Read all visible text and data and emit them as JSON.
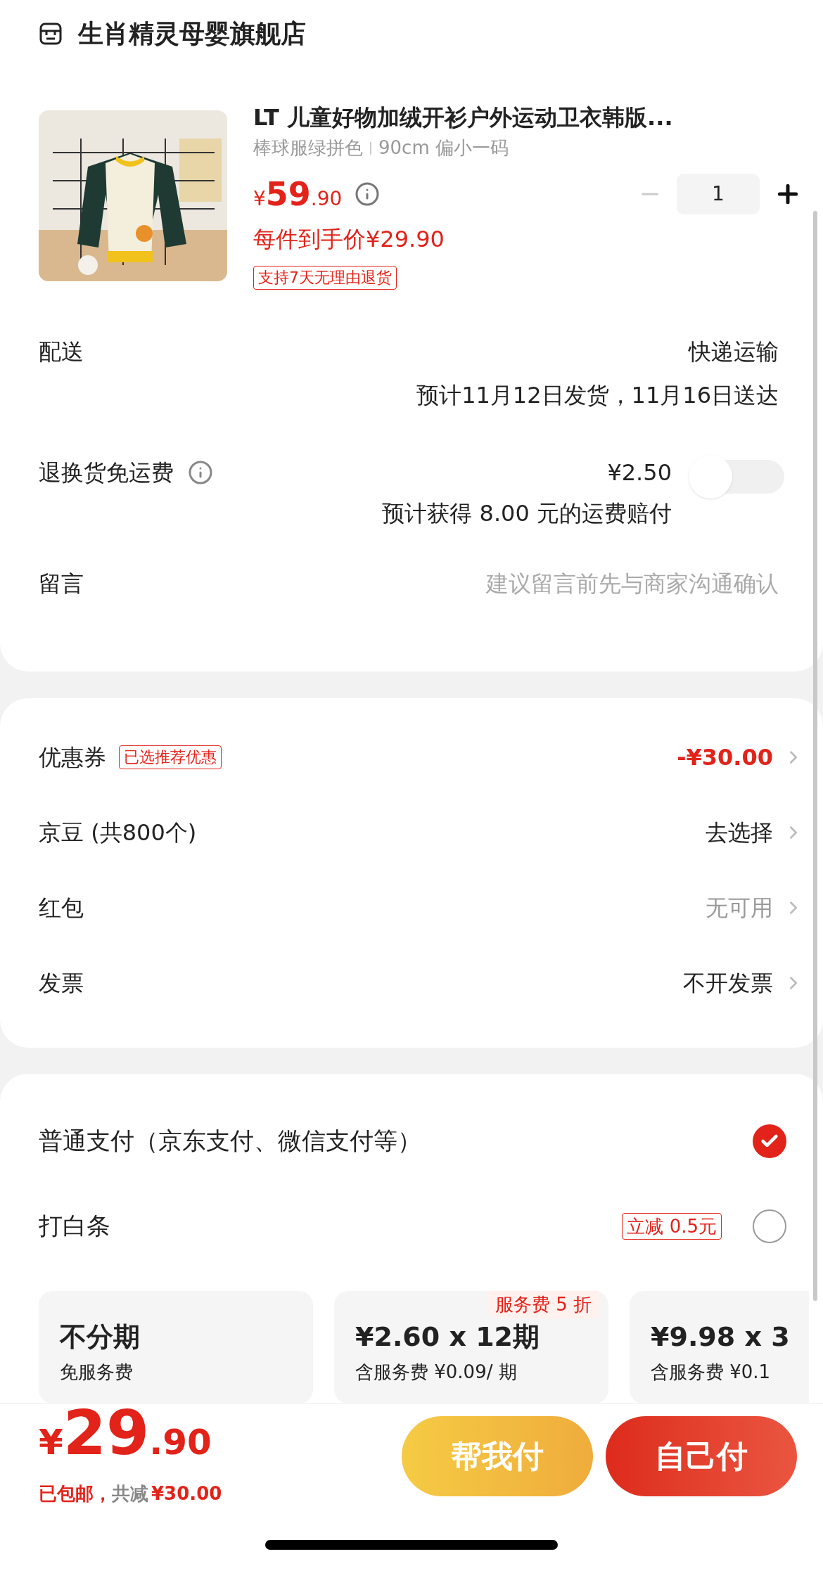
{
  "store": {
    "name": "生肖精灵母婴旗舰店"
  },
  "product": {
    "title": "LT 儿童好物加绒开衫户外运动卫衣韩版...",
    "variant_color": "棒球服绿拼色",
    "variant_size": "90cm 偏小一码",
    "currency": "¥",
    "price_int": "59",
    "price_dec": ".90",
    "quantity": "1",
    "unit_price": "每件到手价¥29.90",
    "tag": "支持7天无理由退货"
  },
  "delivery": {
    "label": "配送",
    "method": "快递运输",
    "estimate": "预计11月12日发货，11月16日送达"
  },
  "return_shipping": {
    "label": "退换货免运费",
    "price": "¥2.50",
    "note": "预计获得 8.00 元的运费赔付",
    "on": false
  },
  "message": {
    "label": "留言",
    "placeholder": "建议留言前先与商家沟通确认"
  },
  "discounts": [
    {
      "label": "优惠券",
      "badge": "已选推荐优惠",
      "value": "-¥30.00",
      "kind": "accent"
    },
    {
      "label": "京豆 (共800个)",
      "value": "去选择",
      "kind": "normal"
    },
    {
      "label": "红包",
      "value": "无可用",
      "kind": "muted"
    },
    {
      "label": "发票",
      "value": "不开发票",
      "kind": "normal"
    }
  ],
  "payment_methods": [
    {
      "label": "普通支付（京东支付、微信支付等）",
      "selected": true
    },
    {
      "label": "打白条",
      "badge": "立减 0.5元",
      "selected": false
    }
  ],
  "installments": [
    {
      "title": "不分期",
      "subtitle": "免服务费"
    },
    {
      "title": "¥2.60 x 12期",
      "subtitle": "含服务费 ¥0.09/ 期",
      "badge": "服务费 5 折"
    },
    {
      "title": "¥9.98 x 3",
      "subtitle": "含服务费 ¥0.1"
    }
  ],
  "footer": {
    "currency": "¥",
    "total_int": "29",
    "total_dec": ".90",
    "shipping": "已包邮，",
    "saved_label": "共减",
    "saved": "¥30.00",
    "buttons": [
      {
        "label": "帮我付",
        "kind": "secondary"
      },
      {
        "label": "自己付",
        "kind": "primary"
      }
    ]
  }
}
